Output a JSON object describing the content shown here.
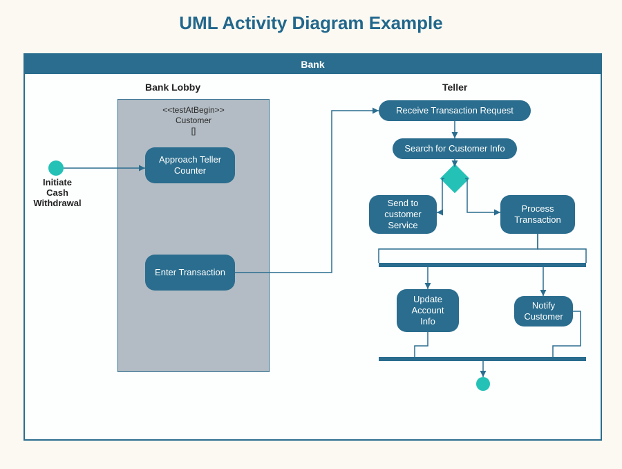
{
  "title": "UML Activity Diagram Example",
  "bank_header": "Bank",
  "swimlanes": {
    "lobby": "Bank Lobby",
    "teller": "Teller"
  },
  "stereotype_line1": "<<testAtBegin>>",
  "stereotype_line2": "Customer",
  "stereotype_line3": "[]",
  "init_label_l1": "Initiate",
  "init_label_l2": "Cash",
  "init_label_l3": "Withdrawal",
  "activities": {
    "approach": "Approach Teller Counter",
    "enterTx": "Enter Transaction",
    "receive": "Receive Transaction Request",
    "search": "Search for Customer Info",
    "sendSvc": "Send to customer Service",
    "procTx": "Process Transaction",
    "updAcct": "Update Account Info",
    "notify": "Notify Customer"
  }
}
